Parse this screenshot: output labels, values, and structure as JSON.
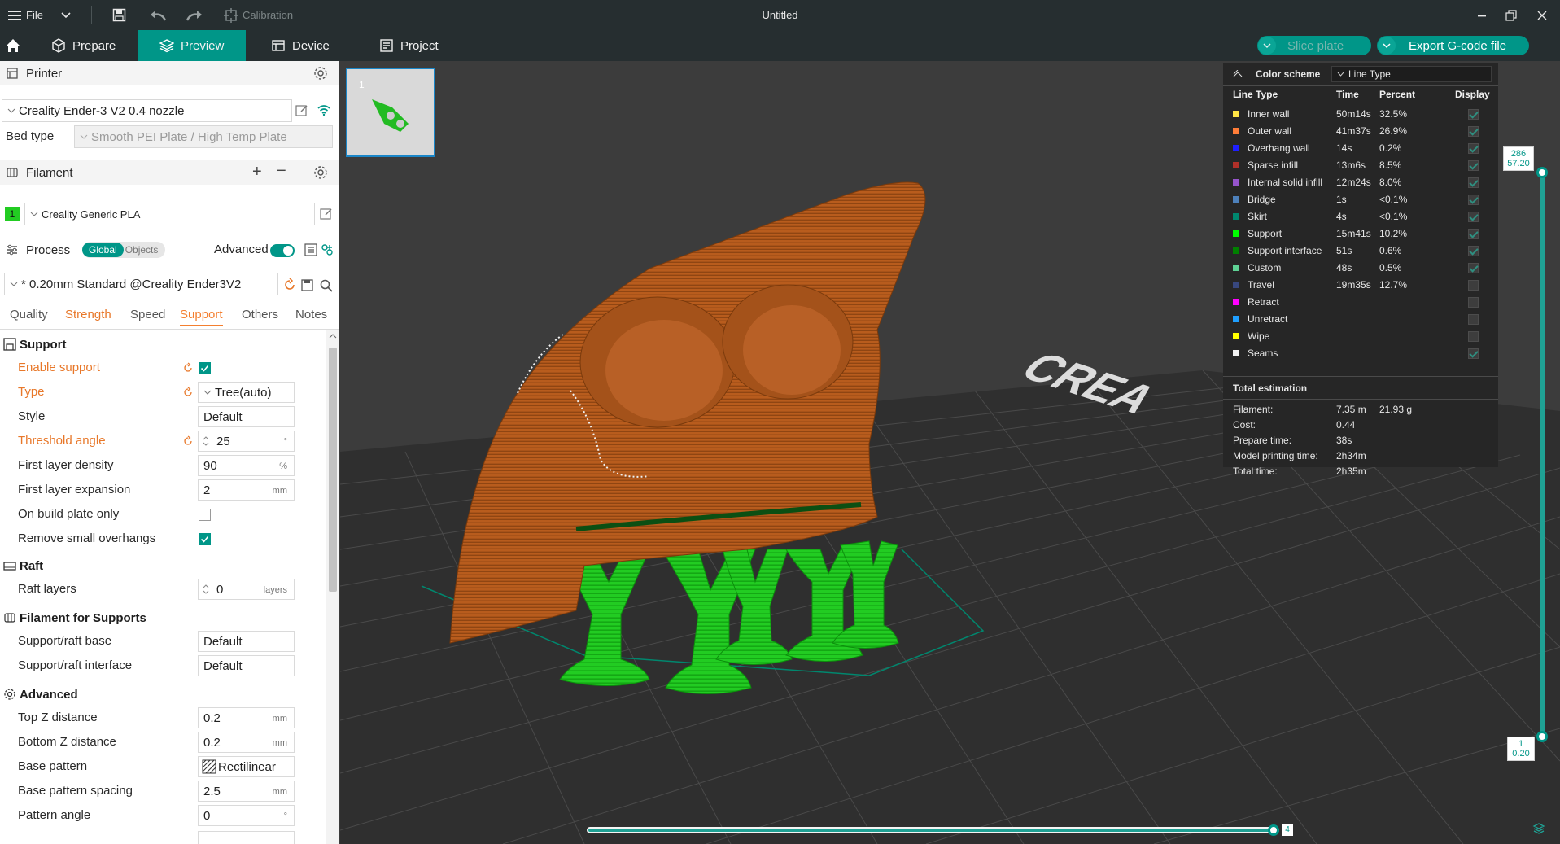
{
  "titlebar": {
    "file_label": "File",
    "calibration_label": "Calibration",
    "title": "Untitled"
  },
  "nav": {
    "prepare": "Prepare",
    "preview": "Preview",
    "device": "Device",
    "project": "Project",
    "slice_plate": "Slice plate",
    "export_gcode": "Export G-code file"
  },
  "printer": {
    "section_label": "Printer",
    "printer_name": "Creality Ender-3 V2 0.4 nozzle",
    "bed_type_label": "Bed type",
    "bed_type_value": "Smooth PEI Plate / High Temp Plate"
  },
  "filament": {
    "section_label": "Filament",
    "slot_number": "1",
    "slot_color": "#22cc22",
    "filament_name": "Creality Generic PLA"
  },
  "process": {
    "section_label": "Process",
    "global_label": "Global",
    "objects_label": "Objects",
    "advanced_label": "Advanced",
    "profile": "* 0.20mm Standard @Creality Ender3V2",
    "tabs": [
      "Quality",
      "Strength",
      "Speed",
      "Support",
      "Others",
      "Notes"
    ]
  },
  "support": {
    "group_support": "Support",
    "enable_support": "Enable support",
    "type_label": "Type",
    "type_value": "Tree(auto)",
    "style_label": "Style",
    "style_value": "Default",
    "threshold_label": "Threshold angle",
    "threshold_value": "25",
    "threshold_unit": "°",
    "first_layer_density_label": "First layer density",
    "first_layer_density_value": "90",
    "first_layer_density_unit": "%",
    "first_layer_expansion_label": "First layer expansion",
    "first_layer_expansion_value": "2",
    "first_layer_expansion_unit": "mm",
    "on_build_plate_label": "On build plate only",
    "remove_small_label": "Remove small overhangs",
    "group_raft": "Raft",
    "raft_layers_label": "Raft layers",
    "raft_layers_value": "0",
    "raft_layers_unit": "layers",
    "group_filament": "Filament for Supports",
    "support_base_label": "Support/raft base",
    "support_base_value": "Default",
    "support_interface_label": "Support/raft interface",
    "support_interface_value": "Default",
    "group_advanced": "Advanced",
    "top_z_label": "Top Z distance",
    "top_z_value": "0.2",
    "bottom_z_label": "Bottom Z distance",
    "bottom_z_value": "0.2",
    "base_pattern_label": "Base pattern",
    "base_pattern_value": "Rectilinear",
    "base_spacing_label": "Base pattern spacing",
    "base_spacing_value": "2.5",
    "pattern_angle_label": "Pattern angle",
    "pattern_angle_value": "0",
    "unit_mm": "mm",
    "unit_deg": "°"
  },
  "legend": {
    "color_scheme_label": "Color scheme",
    "scheme_value": "Line Type",
    "col_line_type": "Line Type",
    "col_time": "Time",
    "col_percent": "Percent",
    "col_display": "Display",
    "rows": [
      {
        "name": "Inner wall",
        "time": "50m14s",
        "percent": "32.5%",
        "color": "#ffe545",
        "display": true
      },
      {
        "name": "Outer wall",
        "time": "41m37s",
        "percent": "26.9%",
        "color": "#ff7d38",
        "display": true
      },
      {
        "name": "Overhang wall",
        "time": "14s",
        "percent": "0.2%",
        "color": "#1f1fff",
        "display": true
      },
      {
        "name": "Sparse infill",
        "time": "13m6s",
        "percent": "8.5%",
        "color": "#b03029",
        "display": true
      },
      {
        "name": "Internal solid infill",
        "time": "12m24s",
        "percent": "8.0%",
        "color": "#9654cc",
        "display": true
      },
      {
        "name": "Bridge",
        "time": "1s",
        "percent": "<0.1%",
        "color": "#4d80ba",
        "display": true
      },
      {
        "name": "Skirt",
        "time": "4s",
        "percent": "<0.1%",
        "color": "#00876e",
        "display": true
      },
      {
        "name": "Support",
        "time": "15m41s",
        "percent": "10.2%",
        "color": "#00ff00",
        "display": true
      },
      {
        "name": "Support interface",
        "time": "51s",
        "percent": "0.6%",
        "color": "#008000",
        "display": true
      },
      {
        "name": "Custom",
        "time": "48s",
        "percent": "0.5%",
        "color": "#5ed194",
        "display": true
      },
      {
        "name": "Travel",
        "time": "19m35s",
        "percent": "12.7%",
        "color": "#38487f",
        "display": false
      },
      {
        "name": "Retract",
        "time": "",
        "percent": "",
        "color": "#ff00ff",
        "display": false
      },
      {
        "name": "Unretract",
        "time": "",
        "percent": "",
        "color": "#1f9fff",
        "display": false
      },
      {
        "name": "Wipe",
        "time": "",
        "percent": "",
        "color": "#ffff00",
        "display": false
      },
      {
        "name": "Seams",
        "time": "",
        "percent": "",
        "color": "#f2f2f2",
        "display": true
      }
    ],
    "total_label": "Total estimation",
    "filament_label": "Filament:",
    "filament_length": "7.35 m",
    "filament_weight": "21.93 g",
    "cost_label": "Cost:",
    "cost_value": "0.44",
    "prepare_label": "Prepare time:",
    "prepare_value": "38s",
    "model_time_label": "Model printing time:",
    "model_time_value": "2h34m",
    "total_time_label": "Total time:",
    "total_time_value": "2h35m"
  },
  "slider": {
    "top_layer": "286",
    "top_height": "57.20",
    "bottom_layer": "1",
    "bottom_height": "0.20",
    "h_value": "4"
  },
  "thumbnail": {
    "plate_number": "1"
  }
}
